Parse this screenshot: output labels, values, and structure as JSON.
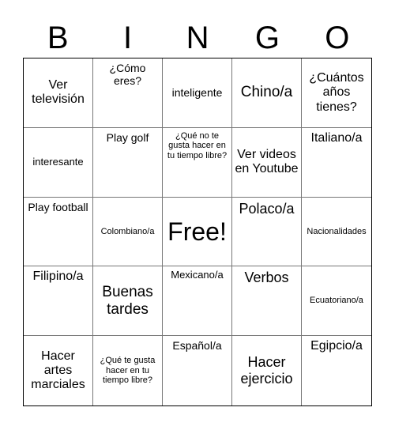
{
  "header": {
    "letters": [
      "B",
      "I",
      "N",
      "G",
      "O"
    ]
  },
  "rows": [
    [
      "Ver televisión",
      "¿Cómo eres?",
      "inteligente",
      "Chino/a",
      "¿Cuántos años tienes?"
    ],
    [
      "interesante",
      "Play golf",
      "¿Qué no te gusta hacer en tu tiempo libre?",
      "Ver videos en Youtube",
      "Italiano/a"
    ],
    [
      "Play football",
      "Colombiano/a",
      "Free!",
      "Polaco/a",
      "Nacionalidades"
    ],
    [
      "Filipino/a",
      "Buenas tardes",
      "Mexicano/a",
      "Verbos",
      "Ecuatoriano/a"
    ],
    [
      "Hacer artes marciales",
      "¿Qué te gusta hacer en tu tiempo libre?",
      "Español/a",
      "Hacer ejercicio",
      "Egipcio/a"
    ]
  ]
}
